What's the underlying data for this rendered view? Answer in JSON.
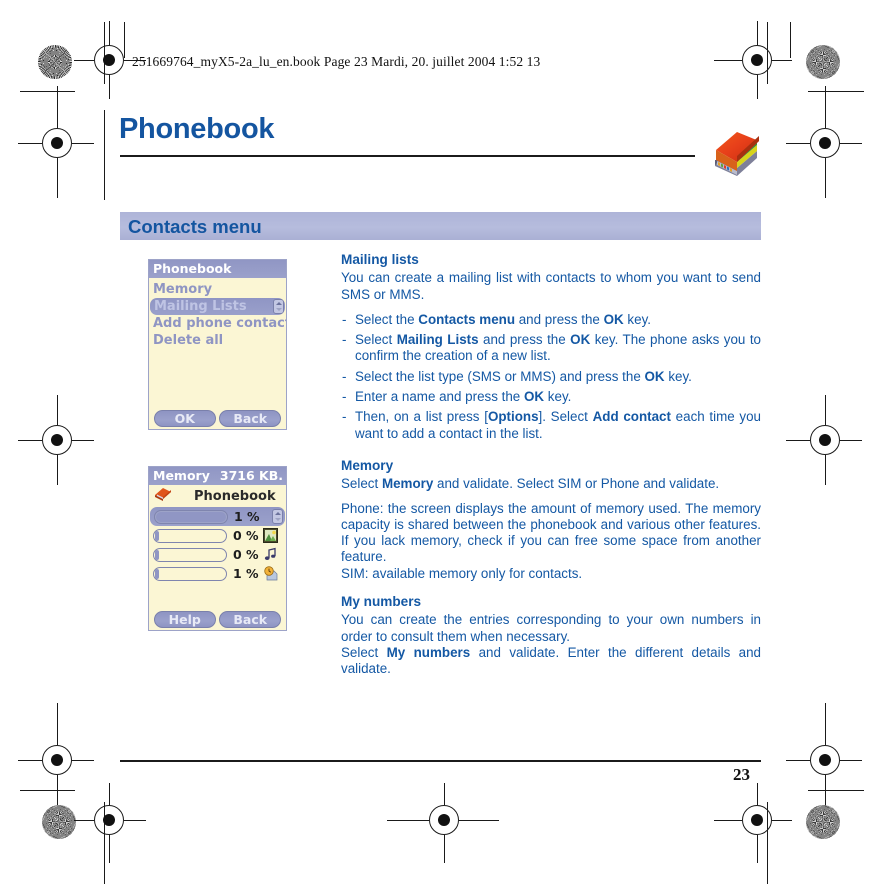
{
  "print_marks": {
    "file_stamp": "251669764_myX5-2a_lu_en.book  Page 23  Mardi, 20. juillet 2004  1:52 13"
  },
  "page": {
    "title": "Phonebook",
    "chapter_icon": "phonebook-book-icon",
    "section_title": "Contacts menu",
    "page_number": "23"
  },
  "phone_screen_1": {
    "titlebar": "Phonebook",
    "items": [
      {
        "label": "Memory",
        "selected": false
      },
      {
        "label": "Mailing Lists",
        "selected": true
      },
      {
        "label": "Add phone contact",
        "selected": false
      },
      {
        "label": "Delete all",
        "selected": false
      }
    ],
    "softkeys": [
      {
        "label": "OK"
      },
      {
        "label": "Back"
      }
    ]
  },
  "phone_screen_2": {
    "titlebar_left": "Memory",
    "titlebar_right": "3716 KB.",
    "header_icon": "book-icon",
    "header_label": "Phonebook",
    "bars": [
      {
        "percent": "1 %",
        "value": 1,
        "icon": "",
        "selected": true
      },
      {
        "percent": "0 %",
        "value": 0,
        "icon": "picture-icon",
        "selected": false
      },
      {
        "percent": "0 %",
        "value": 0,
        "icon": "music-note-icon",
        "selected": false
      },
      {
        "percent": "1 %",
        "value": 1,
        "icon": "clock-document-icon",
        "selected": false
      }
    ],
    "softkeys": [
      {
        "label": "Help"
      },
      {
        "label": "Back"
      }
    ]
  },
  "content": {
    "mailing_lists": {
      "heading": "Mailing lists",
      "intro": "You can create a mailing list with contacts to whom you want to send SMS or MMS.",
      "steps": [
        {
          "a": "Select the ",
          "b1": "Contacts menu",
          "c": " and press the ",
          "b2": "OK",
          "d": " key."
        },
        {
          "a": "Select ",
          "b1": "Mailing Lists",
          "c": " and press the ",
          "b2": "OK",
          "d": " key. The phone asks you to confirm the creation of a new list."
        },
        {
          "a": "Select the list type (SMS or MMS) and press the ",
          "b1": "",
          "c": "",
          "b2": "OK",
          "d": " key."
        },
        {
          "a": "Enter a name and press the ",
          "b1": "",
          "c": "",
          "b2": "OK",
          "d": " key."
        },
        {
          "a": "Then, on a list press [",
          "b1": "Options",
          "c": "]. Select ",
          "b2": "Add contact",
          "d": " each time you want to add a contact in the list."
        }
      ]
    },
    "memory": {
      "heading": "Memory",
      "line1_a": "Select ",
      "line1_b": "Memory",
      "line1_c": " and validate. Select SIM or Phone and validate.",
      "para2": "Phone: the screen displays the amount of memory used. The memory capacity is shared between the phonebook and various other features. If you lack memory, check if you can free some space from another feature.",
      "para3": "SIM: available memory only for contacts."
    },
    "my_numbers": {
      "heading": "My numbers",
      "para1": "You can create the entries corresponding to your own numbers in order to consult them when necessary.",
      "para2_a": "Select ",
      "para2_b": "My numbers",
      "para2_c": " and validate. Enter the different details and validate."
    }
  },
  "colors": {
    "heading_blue": "#1455a0",
    "body_blue": "#1458a4",
    "section_bar": "#b2b8da",
    "phone_screen_bg": "#fbf6d4",
    "phone_accent": "#9096c4"
  }
}
